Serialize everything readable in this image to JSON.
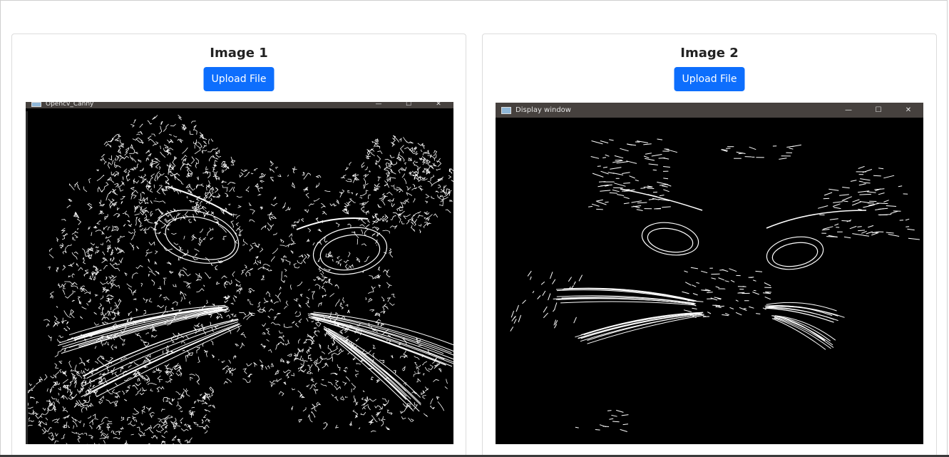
{
  "cards": [
    {
      "title": "Image 1",
      "upload_label": "Upload File",
      "window": {
        "title": "Opencv_Canny",
        "controls": {
          "minimize": "—",
          "maximize": "☐",
          "close": "✕"
        }
      }
    },
    {
      "title": "Image 2",
      "upload_label": "Upload File",
      "window": {
        "title": "Display window",
        "controls": {
          "minimize": "—",
          "maximize": "☐",
          "close": "✕"
        }
      }
    }
  ],
  "colors": {
    "button": "#0d6efd",
    "titlebar": "#46413e",
    "edge_lines": "#ffffff",
    "image_bg": "#000000"
  }
}
